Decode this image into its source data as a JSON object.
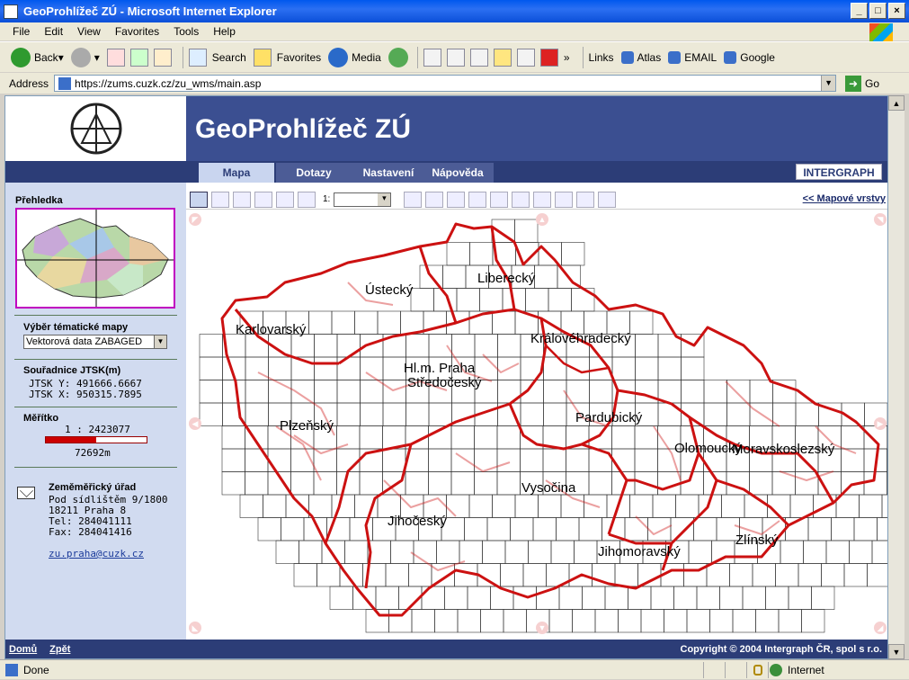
{
  "window": {
    "title": "GeoProhlížeč ZÚ - Microsoft Internet Explorer"
  },
  "menu": [
    "File",
    "Edit",
    "View",
    "Favorites",
    "Tools",
    "Help"
  ],
  "toolbar": {
    "back": "Back",
    "search": "Search",
    "favorites": "Favorites",
    "media": "Media",
    "links_label": "Links",
    "links": [
      "Atlas",
      "EMAIL",
      "Google"
    ]
  },
  "address": {
    "label": "Address",
    "url": "https://zums.cuzk.cz/zu_wms/main.asp",
    "go": "Go"
  },
  "app": {
    "title": "GeoProhlížeč ZÚ",
    "tabs": [
      "Mapa",
      "Dotazy",
      "Nastavení",
      "Nápověda"
    ],
    "active_tab": "Mapa",
    "brand": "INTERGRAPH",
    "layers_link": "<< Mapové vrstvy",
    "scale_prefix": "1:"
  },
  "sidebar": {
    "overview_label": "Přehledka",
    "theme_label": "Výběr tématické mapy",
    "theme_value": "Vektorová data ZABAGED",
    "coords_label": "Souřadnice JTSK(m)",
    "jtsk_y": "JTSK Y: 491666.6667",
    "jtsk_x": "JTSK X: 950315.7895",
    "scale_label": "Měřítko",
    "scale_value": "1 : 2423077",
    "scale_distance": "72692m",
    "office_name": "Zeměměřický úřad",
    "office_lines": [
      "Pod sídlištěm 9/1800",
      "18211 Praha 8",
      "Tel: 284041111",
      "Fax: 284041416"
    ],
    "email": "zu.praha@cuzk.cz"
  },
  "map": {
    "regions": [
      "Ústecký",
      "Liberecký",
      "Karlovarský",
      "Královéhradecký",
      "Hl.m. Praha",
      "Středočeský",
      "Pardubický",
      "Plzeňský",
      "Olomoucký",
      "Moravskoslezský",
      "Vysočina",
      "Jihočeský",
      "Jihomoravský",
      "Zlínský"
    ],
    "border_color": "#cc1111",
    "grid_color": "#333333"
  },
  "footer": {
    "home": "Domů",
    "back": "Zpět",
    "copyright": "Copyright © 2004 Intergraph ČR, spol s r.o."
  },
  "status": {
    "done": "Done",
    "zone": "Internet"
  }
}
